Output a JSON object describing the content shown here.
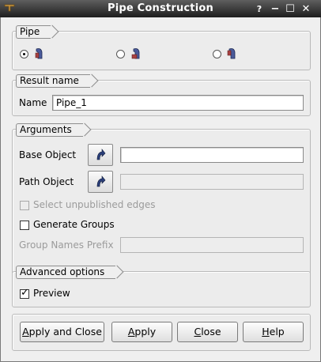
{
  "window": {
    "title": "Pipe Construction",
    "help_glyph": "?",
    "minimize_glyph": "−",
    "maximize_glyph": "☐",
    "close_glyph": "✕"
  },
  "pipe_group": {
    "title": "Pipe",
    "options": [
      {
        "checked": true,
        "icon": "pipe-shape-icon-1"
      },
      {
        "checked": false,
        "icon": "pipe-shape-icon-2"
      },
      {
        "checked": false,
        "icon": "pipe-shape-icon-3"
      }
    ]
  },
  "result_group": {
    "title": "Result name",
    "name_label": "Name",
    "name_value": "Pipe_1"
  },
  "arguments_group": {
    "title": "Arguments",
    "base_object_label": "Base Object",
    "base_object_value": "",
    "path_object_label": "Path Object",
    "path_object_value": "",
    "select_unpublished_label": "Select unpublished edges",
    "select_unpublished_checked": false,
    "generate_groups_label": "Generate Groups",
    "generate_groups_checked": false,
    "group_prefix_label": "Group Names Prefix",
    "group_prefix_value": ""
  },
  "advanced_group": {
    "title": "Advanced options",
    "preview_label": "Preview",
    "preview_checked": true
  },
  "buttons": {
    "apply_close_pre": "",
    "apply_close_mn": "A",
    "apply_close_post": "pply and Close",
    "apply_pre": "",
    "apply_mn": "A",
    "apply_post": "pply",
    "close_pre": "",
    "close_mn": "C",
    "close_post": "lose",
    "help_pre": "",
    "help_mn": "H",
    "help_post": "elp"
  },
  "colors": {
    "title_bar": "#2a2a2a",
    "background": "#efefef",
    "selection_arrow": "#2b3f7a"
  }
}
